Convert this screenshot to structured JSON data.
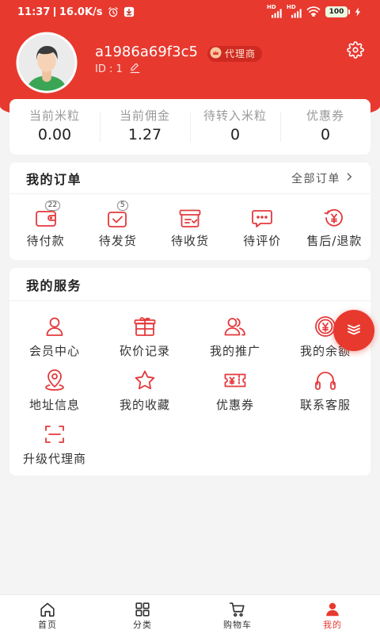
{
  "status_bar": {
    "time": "11:37",
    "net_speed": "16.0K/s",
    "signal_labels": [
      "HD",
      "HD"
    ],
    "battery": "100"
  },
  "profile": {
    "username": "a1986a69f3c5",
    "badge_label": "代理商",
    "id_text": "ID : 1"
  },
  "stats": [
    {
      "label": "当前米粒",
      "value": "0.00"
    },
    {
      "label": "当前佣金",
      "value": "1.27"
    },
    {
      "label": "待转入米粒",
      "value": "0"
    },
    {
      "label": "优惠券",
      "value": "0"
    }
  ],
  "orders": {
    "title": "我的订单",
    "all_label": "全部订单",
    "items": [
      {
        "label": "待付款",
        "icon": "wallet-icon",
        "badge": "22"
      },
      {
        "label": "待发货",
        "icon": "package-check-icon",
        "badge": "5"
      },
      {
        "label": "待收货",
        "icon": "box-icon"
      },
      {
        "label": "待评价",
        "icon": "comment-icon"
      },
      {
        "label": "售后/退款",
        "icon": "refund-icon"
      }
    ]
  },
  "services": {
    "title": "我的服务",
    "items": [
      {
        "label": "会员中心",
        "icon": "member-icon"
      },
      {
        "label": "砍价记录",
        "icon": "gift-icon"
      },
      {
        "label": "我的推广",
        "icon": "users-icon"
      },
      {
        "label": "我的余额",
        "icon": "coin-icon"
      },
      {
        "label": "地址信息",
        "icon": "location-icon"
      },
      {
        "label": "我的收藏",
        "icon": "star-icon"
      },
      {
        "label": "优惠券",
        "icon": "coupon-icon"
      },
      {
        "label": "联系客服",
        "icon": "headset-icon"
      },
      {
        "label": "升级代理商",
        "icon": "scan-icon"
      }
    ]
  },
  "tabbar": {
    "items": [
      {
        "label": "首页",
        "icon": "home-icon",
        "active": false
      },
      {
        "label": "分类",
        "icon": "grid-icon",
        "active": false
      },
      {
        "label": "购物车",
        "icon": "cart-icon",
        "active": false
      },
      {
        "label": "我的",
        "icon": "user-icon",
        "active": true
      }
    ]
  },
  "colors": {
    "primary": "#e8392f",
    "icon": "#e4393c",
    "background": "#f4f4f4",
    "text": "#333333",
    "muted": "#9a9a9a"
  }
}
